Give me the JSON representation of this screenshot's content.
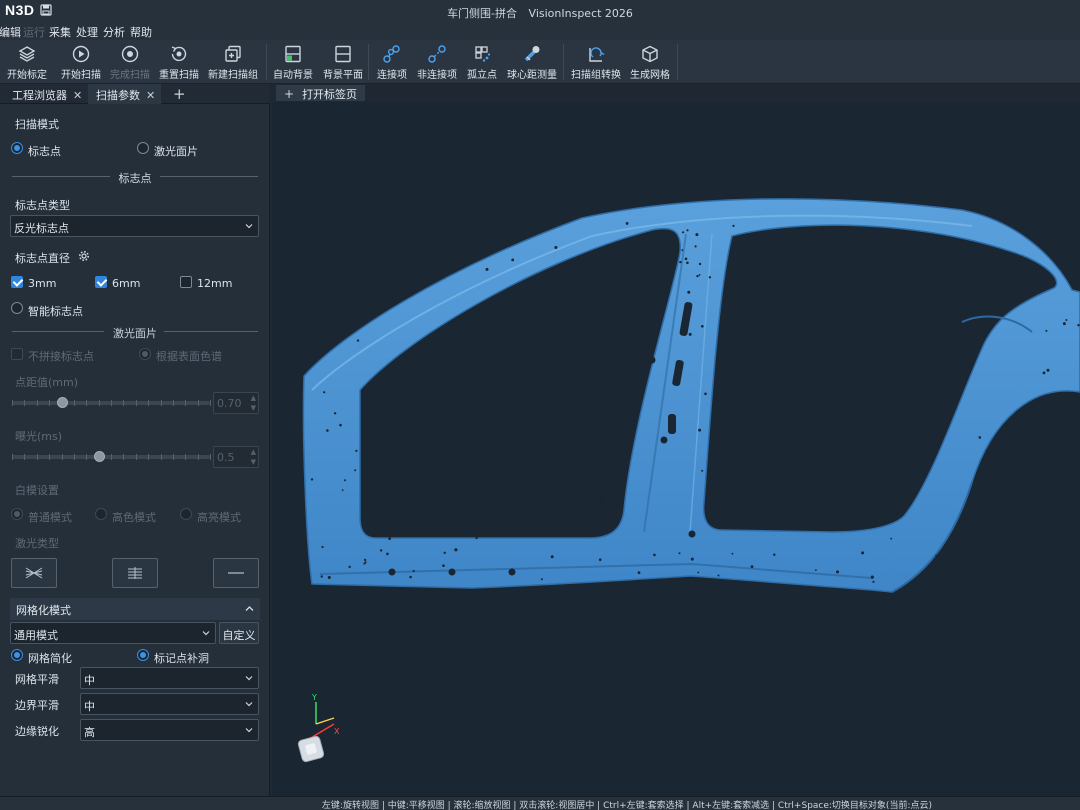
{
  "app": {
    "logo": "N3D",
    "window_title": "车门侧围-拼合",
    "product": "VisionInspect 2026"
  },
  "menu": {
    "items": [
      {
        "label": "编辑",
        "enabled": true
      },
      {
        "label": "运行",
        "enabled": false
      },
      {
        "label": "采集",
        "enabled": true
      },
      {
        "label": "处理",
        "enabled": true
      },
      {
        "label": "分析",
        "enabled": true
      },
      {
        "label": "帮助",
        "enabled": true
      }
    ]
  },
  "toolbar": {
    "buttons": [
      {
        "label": "开始标定",
        "icon": "calibrate-icon",
        "enabled": true
      },
      {
        "label": "开始扫描",
        "icon": "play-icon",
        "enabled": true
      },
      {
        "label": "完成扫描",
        "icon": "stop-icon",
        "enabled": false
      },
      {
        "label": "重置扫描",
        "icon": "reset-scan-icon",
        "enabled": true
      },
      {
        "label": "新建扫描组",
        "icon": "new-group-icon",
        "enabled": true
      },
      {
        "label": "自动背景",
        "icon": "auto-background-icon",
        "enabled": true
      },
      {
        "label": "背景平面",
        "icon": "background-plane-icon",
        "enabled": true
      },
      {
        "label": "连接项",
        "icon": "connect-icon",
        "enabled": true
      },
      {
        "label": "非连接项",
        "icon": "disconnect-icon",
        "enabled": true
      },
      {
        "label": "孤立点",
        "icon": "isolated-points-icon",
        "enabled": true
      },
      {
        "label": "球心距测量",
        "icon": "sphere-measure-icon",
        "enabled": true
      },
      {
        "label": "扫描组转换",
        "icon": "group-convert-icon",
        "enabled": true
      },
      {
        "label": "生成网格",
        "icon": "mesh-cube-icon",
        "enabled": true
      }
    ]
  },
  "panel_tabs": [
    {
      "label": "工程浏览器",
      "close": "✕"
    },
    {
      "label": "扫描参数",
      "close": "✕"
    }
  ],
  "panel_add": "+",
  "scan": {
    "mode_label": "扫描模式",
    "mode_options": [
      "标志点",
      "激光面片"
    ],
    "mode_selected": 0,
    "marker_section": "标志点",
    "marker_type_label": "标志点类型",
    "marker_type_value": "反光标志点",
    "marker_diameter_label": "标志点直径",
    "diameters": [
      {
        "label": "3mm",
        "checked": true
      },
      {
        "label": "6mm",
        "checked": true
      },
      {
        "label": "12mm",
        "checked": false
      }
    ],
    "smart_marker_label": "智能标志点",
    "laser_section": "激光面片",
    "laser_options": [
      "不拼接标志点",
      "根据表面色谱"
    ],
    "point_spacing_label": "点距值(mm)",
    "point_spacing_value": "0.70",
    "point_spacing_fraction": 0.25,
    "exposure_label": "曝光(ms)",
    "exposure_value": "0.5",
    "exposure_fraction": 0.44,
    "whiteline_label": "白模设置",
    "whiteline_options": [
      "普通模式",
      "高色模式",
      "高亮模式"
    ],
    "laser_type_label": "激光类型"
  },
  "mesh": {
    "header": "网格化模式",
    "mode_value": "通用模式",
    "custom_button": "自定义",
    "options": [
      "网格简化",
      "标记点补洞"
    ],
    "rows": [
      {
        "label": "网格平滑",
        "value": "中"
      },
      {
        "label": "边界平滑",
        "value": "中"
      },
      {
        "label": "边缘锐化",
        "value": "高"
      }
    ]
  },
  "viewport": {
    "tab_plus": "+",
    "tab_label": "打开标签页",
    "axis_y": "Y",
    "axis_x": "X"
  },
  "colors": {
    "model": "#4a90d0",
    "accent": "#3a8fe0",
    "viewport_bg": "#1b2633"
  },
  "status": {
    "hint": "左键:旋转视图 | 中键:平移视图 | 滚轮:缩放视图 | 双击滚轮:视图居中 | Ctrl+左键:套索选择 | Alt+左键:套索减选 | Ctrl+Space:切换目标对象(当前:点云)"
  }
}
